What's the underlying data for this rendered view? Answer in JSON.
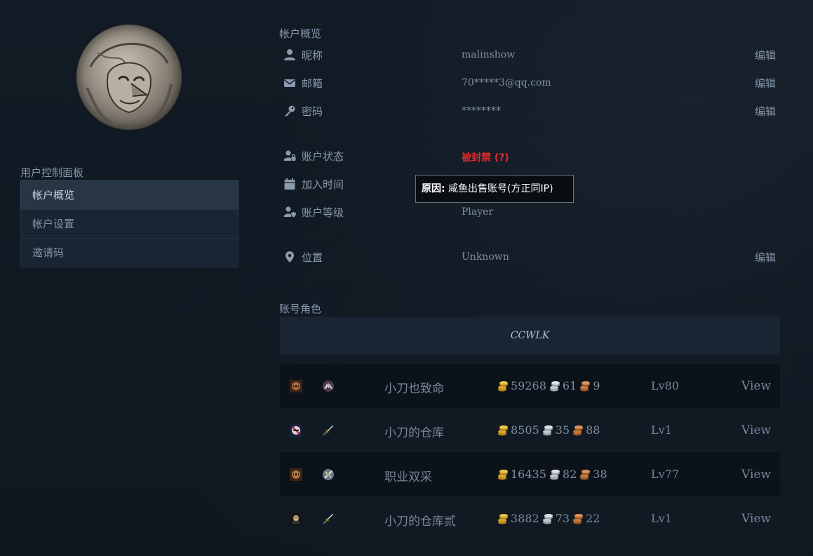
{
  "sidebar": {
    "panel_title": "用户控制面板",
    "items": [
      {
        "label": "帐户概览",
        "active": true
      },
      {
        "label": "帐户设置",
        "active": false
      },
      {
        "label": "邀请码",
        "active": false
      }
    ]
  },
  "overview": {
    "title": "帐户概览",
    "nickname": {
      "icon": "user-icon",
      "label": "昵称",
      "value": "malinshow",
      "edit": "编辑"
    },
    "email": {
      "icon": "envelope-icon",
      "label": "邮箱",
      "value": "70*****3@qq.com",
      "edit": "编辑"
    },
    "password": {
      "icon": "key-icon",
      "label": "密码",
      "value": "********",
      "edit": "编辑"
    },
    "status": {
      "icon": "user-lock-icon",
      "label": "账户状态",
      "value": "被封禁 (?)",
      "color": "#e02a2a"
    },
    "joined": {
      "icon": "calendar-icon",
      "label": "加入时间",
      "value": ""
    },
    "level": {
      "icon": "user-shield-icon",
      "label": "账户等级",
      "value": "Player"
    },
    "location": {
      "icon": "map-pin-icon",
      "label": "位置",
      "value": "Unknown",
      "edit": "编辑"
    }
  },
  "tooltip": {
    "prefix": "原因:",
    "text": " 咸鱼出售账号(方正同IP)"
  },
  "characters": {
    "title": "账号角色",
    "realm": "CCWLK",
    "rows": [
      {
        "race_icon": "race-icon",
        "class_icon": "class-icon",
        "name": "小刀也致命",
        "gold": "59268",
        "silver": "61",
        "copper": "9",
        "level": "Lv80",
        "action": "View"
      },
      {
        "race_icon": "race-icon",
        "class_icon": "sword-class-icon",
        "name": "小刀的仓库",
        "gold": "8505",
        "silver": "35",
        "copper": "88",
        "level": "Lv1",
        "action": "View"
      },
      {
        "race_icon": "race-icon",
        "class_icon": "class-icon",
        "name": "职业双采",
        "gold": "16435",
        "silver": "82",
        "copper": "38",
        "level": "Lv77",
        "action": "View"
      },
      {
        "race_icon": "race-icon",
        "class_icon": "sword-class-icon",
        "name": "小刀的仓库贰",
        "gold": "3882",
        "silver": "73",
        "copper": "22",
        "level": "Lv1",
        "action": "View"
      }
    ]
  },
  "colors": {
    "background": "#111a24",
    "panel": "#1a2533",
    "banned": "#e02a2a",
    "gold": "#d4a72c",
    "silver": "#c2c6cc",
    "copper": "#c57a3d"
  }
}
